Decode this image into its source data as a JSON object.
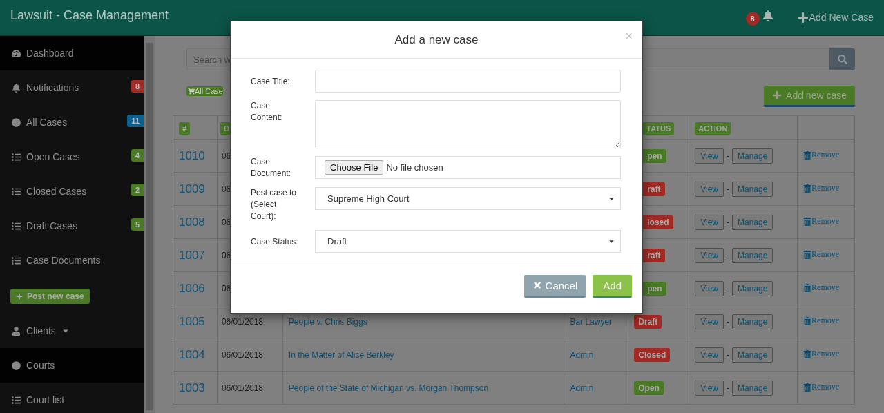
{
  "app_title": "Lawsuit - Case Management",
  "topbar": {
    "notification_count": "8",
    "add_link": "Add New Case"
  },
  "sidebar": {
    "items": [
      {
        "kind": "dashboard",
        "label": "Dashboard",
        "selected": true
      },
      {
        "kind": "bell",
        "label": "Notifications",
        "selected": false,
        "badge": {
          "text": "8",
          "color": "#a12a24"
        }
      },
      {
        "kind": "circle",
        "label": "All Cases",
        "selected": false,
        "badge": {
          "text": "11",
          "color": "#0d5f8e"
        }
      },
      {
        "kind": "list",
        "label": "Open Cases",
        "selected": false,
        "badge": {
          "text": "4",
          "color": "#4a7a26"
        }
      },
      {
        "kind": "list",
        "label": "Closed Cases",
        "selected": false,
        "badge": {
          "text": "2",
          "color": "#4a7a26"
        }
      },
      {
        "kind": "list",
        "label": "Draft Cases",
        "selected": false,
        "badge": {
          "text": "5",
          "color": "#4a7a26"
        }
      },
      {
        "kind": "list",
        "label": "Case Documents",
        "selected": false
      },
      {
        "kind": "button",
        "label": "Post new case"
      },
      {
        "kind": "user",
        "label": "Clients",
        "selected": false,
        "dropdown": true
      },
      {
        "kind": "circle",
        "label": "Courts",
        "selected": true
      },
      {
        "kind": "list",
        "label": "Court list",
        "selected": false
      }
    ]
  },
  "search": {
    "placeholder": "Search w"
  },
  "all_cases_button": "All Case",
  "add_case_button": "Add new case",
  "table": {
    "columns": [
      "#",
      "D",
      "TATUS",
      "ACTION"
    ],
    "rows": [
      {
        "number": "1010",
        "date": "06",
        "status": {
          "text": "pen",
          "color": "#4a7a26"
        },
        "actions": [
          "View",
          "-",
          "Manage"
        ],
        "remove": "Remove"
      },
      {
        "number": "1009",
        "date": "06",
        "status": {
          "text": "raft",
          "color": "#a12a24"
        },
        "actions": [
          "View",
          "-",
          "Manage"
        ],
        "remove": "Remove"
      },
      {
        "number": "1008",
        "date": "06",
        "status": {
          "text": "losed",
          "color": "#a12a24"
        },
        "actions": [
          "View",
          "-",
          "Manage"
        ],
        "remove": "Remove"
      },
      {
        "number": "1007",
        "date": "06",
        "status": {
          "text": "raft",
          "color": "#a12a24"
        },
        "actions": [
          "View",
          "-",
          "Manage"
        ],
        "remove": "Remove"
      },
      {
        "number": "1006",
        "date": "06",
        "status": {
          "text": "pen",
          "color": "#4a7a26"
        },
        "actions": [
          "View",
          "-",
          "Manage"
        ],
        "remove": "Remove"
      },
      {
        "number": "1005",
        "date": "06/01/2018",
        "title": "People v. Chris Biggs",
        "author": "Bar Lawyer",
        "status": {
          "text": "Draft",
          "color": "#a12a24"
        },
        "actions": [
          "View",
          "-",
          "Manage"
        ],
        "remove": "Remove"
      },
      {
        "number": "1004",
        "date": "06/01/2018",
        "title": "In the Matter of Alice Berkley",
        "author": "Admin",
        "status": {
          "text": "Closed",
          "color": "#a12a24"
        },
        "actions": [
          "View",
          "-",
          "Manage"
        ],
        "remove": "Remove"
      },
      {
        "number": "1003",
        "date": "06/01/2018",
        "title": "People of the State of Michigan vs. Morgan Thompson",
        "author": "Admin",
        "status": {
          "text": "Open",
          "color": "#4a7a26"
        },
        "actions": [
          "View",
          "-",
          "Manage"
        ],
        "remove": "Remove"
      }
    ]
  },
  "dialog": {
    "title": "Add a new case",
    "close": "×",
    "fields": [
      {
        "kind": "text",
        "label": "Case Title:"
      },
      {
        "kind": "textarea",
        "label": "Case Content:"
      },
      {
        "kind": "file",
        "label": "Case Document:",
        "button": "Choose File",
        "value": "No file chosen"
      },
      {
        "kind": "select",
        "label": "Post case to (Select Court):",
        "value": "Supreme High Court"
      },
      {
        "kind": "select",
        "label": "Case Status:",
        "value": "Draft"
      }
    ],
    "buttons": [
      {
        "kind": "cancel",
        "label": "Cancel"
      },
      {
        "kind": "primary",
        "label": "Add"
      }
    ]
  }
}
